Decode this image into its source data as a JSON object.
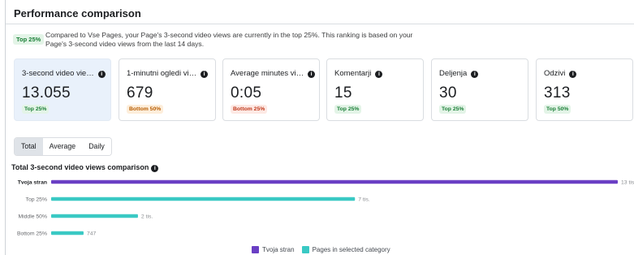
{
  "panel": {
    "title": "Performance comparison",
    "summary_badge": "Top 25%",
    "summary_text": "Compared to Vse Pages, your Page's 3-second video views are currently in the top 25%. This ranking is based on your Page's 3-second video views from the last 14 days."
  },
  "cards": [
    {
      "label": "3-second video vie…",
      "value": "13.055",
      "badge": "Top 25%",
      "badge_kind": "green",
      "selected": true
    },
    {
      "label": "1-minutni ogledi vi…",
      "value": "679",
      "badge": "Bottom 50%",
      "badge_kind": "orange",
      "selected": false
    },
    {
      "label": "Average minutes vi…",
      "value": "0:05",
      "badge": "Bottom 25%",
      "badge_kind": "red",
      "selected": false
    },
    {
      "label": "Komentarji",
      "value": "15",
      "badge": "Top 25%",
      "badge_kind": "green",
      "selected": false
    },
    {
      "label": "Deljenja",
      "value": "30",
      "badge": "Top 25%",
      "badge_kind": "green",
      "selected": false
    },
    {
      "label": "Odzivi",
      "value": "313",
      "badge": "Top 50%",
      "badge_kind": "green",
      "selected": false
    }
  ],
  "tabs": [
    {
      "label": "Total",
      "active": true
    },
    {
      "label": "Average",
      "active": false
    },
    {
      "label": "Daily",
      "active": false
    }
  ],
  "colors": {
    "own_page": "#6a3fc4",
    "category": "#3ac9c4"
  },
  "chart_data": {
    "type": "bar",
    "orientation": "horizontal",
    "title": "Total 3-second video views comparison",
    "categories": [
      "Tvoja stran",
      "Top 25%",
      "Middle 50%",
      "Bottom 25%"
    ],
    "values": [
      13055,
      7000,
      2000,
      747
    ],
    "value_labels": [
      "13 tis.",
      "7 tis.",
      "2 tis.",
      "747"
    ],
    "highlight_index": 0,
    "series": [
      {
        "name": "Tvoja stran",
        "color": "#6a3fc4"
      },
      {
        "name": "Pages in selected category",
        "color": "#3ac9c4"
      }
    ],
    "xlim": [
      0,
      13055
    ],
    "grid": false,
    "legend": "bottom-center"
  }
}
